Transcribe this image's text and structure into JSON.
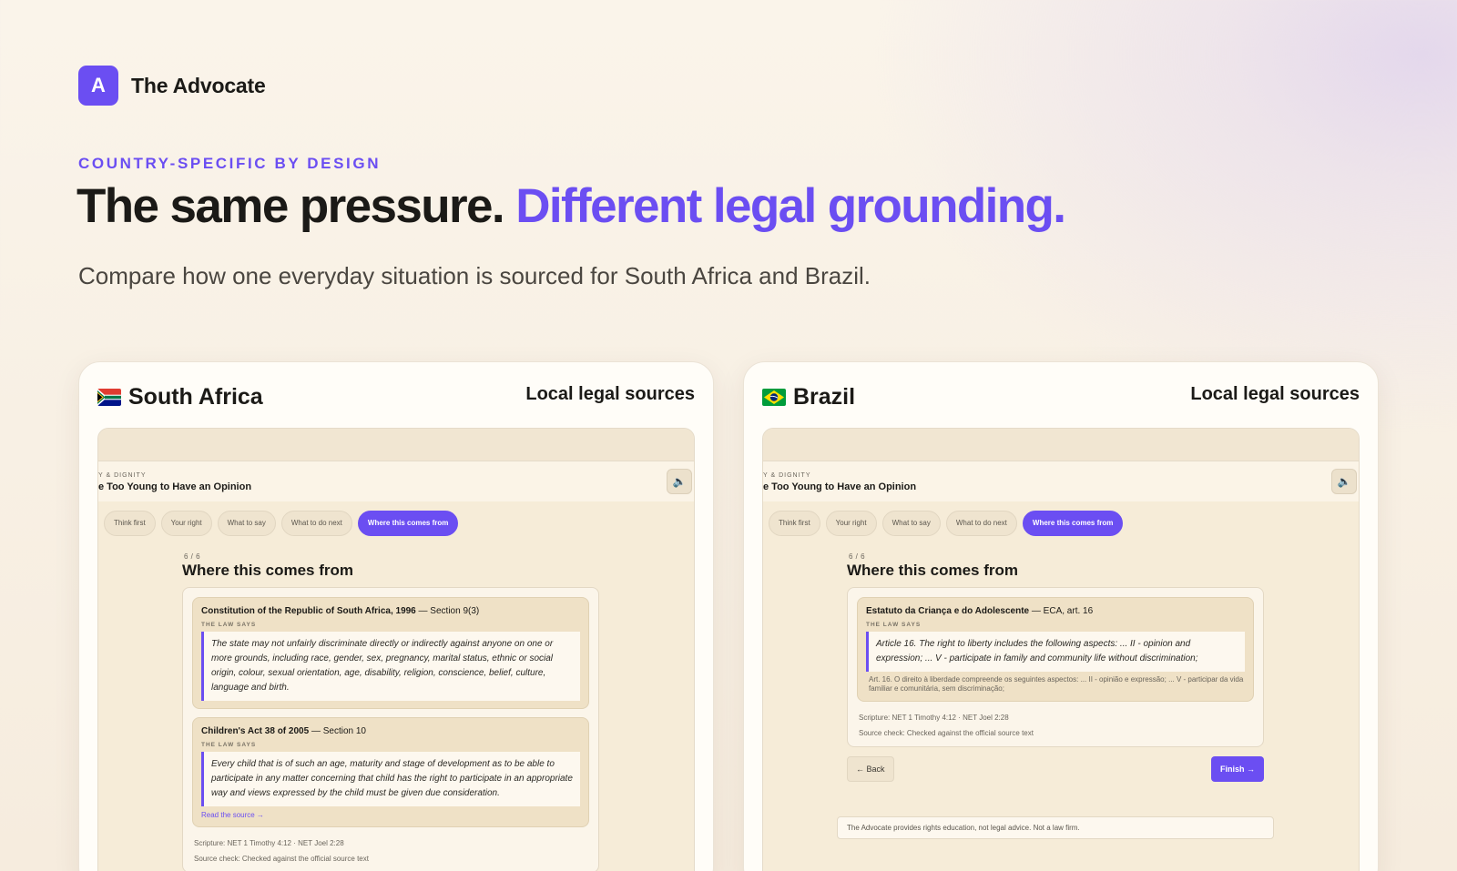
{
  "brand": {
    "logo_letter": "A",
    "name": "The Advocate",
    "accent": "#6b4ef2"
  },
  "hero": {
    "eyebrow": "COUNTRY-SPECIFIC BY DESIGN",
    "headline_plain": "The same pressure.",
    "headline_accent": "Different legal grounding.",
    "subhead": "Compare how one everyday situation is sourced for South Africa and Brazil."
  },
  "panels": [
    {
      "country": "South Africa",
      "flag": "flag-south-africa-icon",
      "sources_label": "Local legal sources",
      "screen": {
        "crumb": "Y & DIGNITY",
        "title": "e Too Young to Have an Opinion",
        "speaker": "speaker-icon",
        "tabs": [
          "Think first",
          "Your right",
          "What to say",
          "What to do next",
          "Where this comes from"
        ],
        "active_tab": 4,
        "step": "6 / 6",
        "section_title": "Where this comes from",
        "laws": [
          {
            "title": "Constitution of the Republic of South Africa, 1996",
            "section": " — Section 9(3)",
            "kicker": "THE LAW SAYS",
            "quote": "The state may not unfairly discriminate directly or indirectly against anyone on one or more grounds, including race, gender, sex, pregnancy, marital status, ethnic or social origin, colour, sexual orientation, age, disability, religion, conscience, belief, culture, language and birth."
          },
          {
            "title": "Children's Act 38 of 2005",
            "section": " — Section 10",
            "kicker": "THE LAW SAYS",
            "quote": "Every child that is of such an age, maturity and stage of development as to be able to participate in any matter concerning that child has the right to participate in an appropriate way and views expressed by the child must be given due consideration.",
            "link": "Read the source →"
          }
        ],
        "scripture": "Scripture: NET 1 Timothy 4:12 · NET Joel 2:28",
        "source_check": "Source check: Checked against the official source text"
      }
    },
    {
      "country": "Brazil",
      "flag": "flag-brazil-icon",
      "sources_label": "Local legal sources",
      "screen": {
        "crumb": "Y & DIGNITY",
        "title": "e Too Young to Have an Opinion",
        "speaker": "speaker-icon",
        "tabs": [
          "Think first",
          "Your right",
          "What to say",
          "What to do next",
          "Where this comes from"
        ],
        "active_tab": 4,
        "step": "6 / 6",
        "section_title": "Where this comes from",
        "laws": [
          {
            "title": "Estatuto da Criança e do Adolescente",
            "section": " — ECA, art. 16",
            "kicker": "THE LAW SAYS",
            "quote": "Article 16. The right to liberty includes the following aspects: ... II - opinion and expression; ... V - participate in family and community life without discrimination;",
            "original": "Art. 16. O direito à liberdade compreende os seguintes aspectos: ... II - opinião e expressão; ... V - participar da vida familiar e comunitária, sem discriminação;"
          }
        ],
        "scripture": "Scripture: NET 1 Timothy 4:12 · NET Joel 2:28",
        "source_check": "Source check: Checked against the official source text",
        "back_label": "← Back",
        "finish_label": "Finish →",
        "disclaimer": "The Advocate provides rights education, not legal advice. Not a law firm."
      }
    }
  ]
}
